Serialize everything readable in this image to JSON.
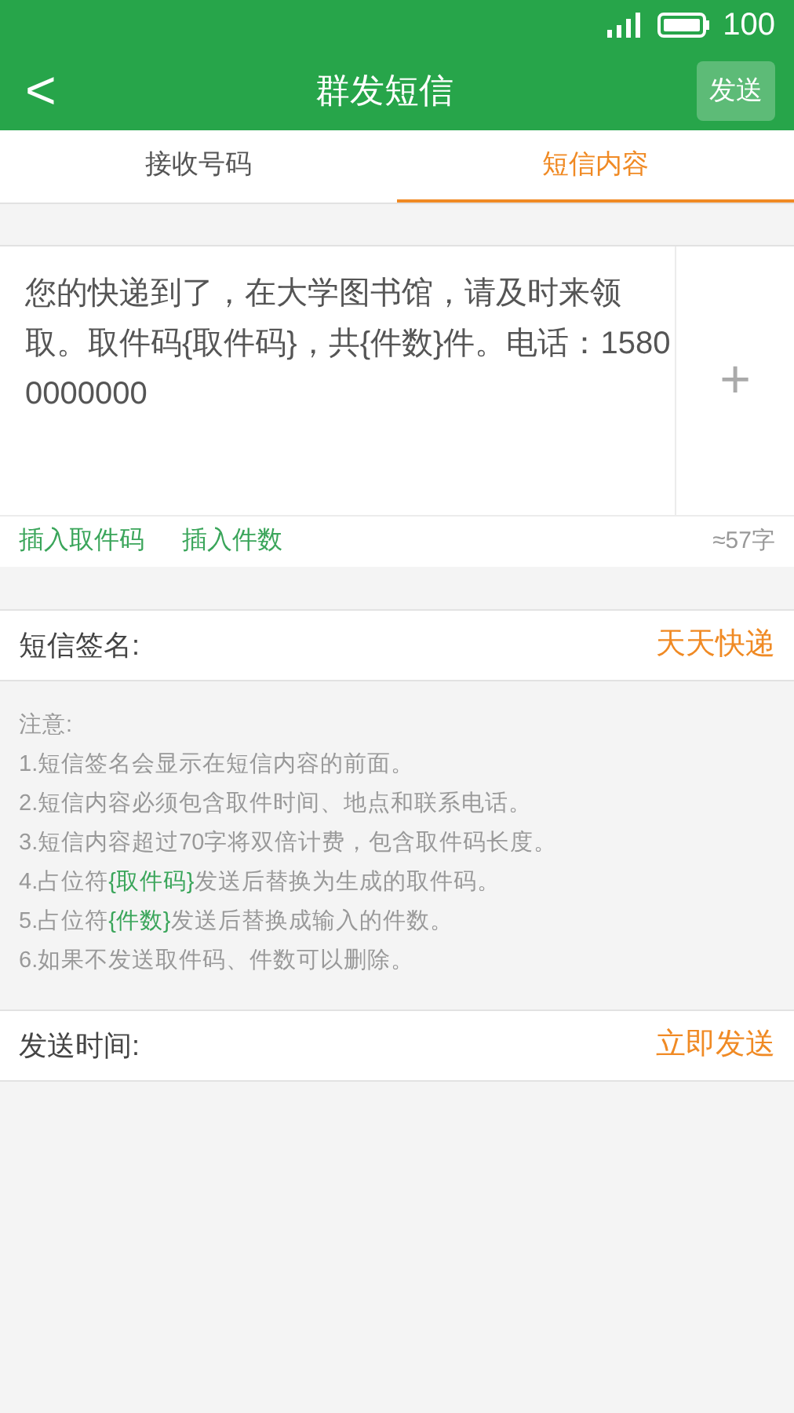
{
  "status_bar": {
    "battery": "100"
  },
  "header": {
    "back": "<",
    "title": "群发短信",
    "send_button": "发送"
  },
  "tabs": [
    {
      "label": "接收号码",
      "selected": false
    },
    {
      "label": "短信内容",
      "selected": true
    }
  ],
  "message": {
    "value": "您的快递到了，在大学图书馆，请及时来领取。取件码{取件码}，共{件数}件。电话：15800000000",
    "add": "+",
    "count": "≈57字"
  },
  "insert_links": [
    "插入取件码",
    "插入件数"
  ],
  "signature": {
    "label": "短信签名:",
    "value": "天天快递"
  },
  "notes": {
    "title": "注意:",
    "items": [
      [
        {
          "text": "1.短信签名会显示在短信内容的前面。",
          "highlight": false
        }
      ],
      [
        {
          "text": "2.短信内容必须包含取件时间、地点和联系电话。",
          "highlight": false
        }
      ],
      [
        {
          "text": "3.短信内容超过70字将双倍计费，包含取件码长度。",
          "highlight": false
        }
      ],
      [
        {
          "text": "4.占位符",
          "highlight": false
        },
        {
          "text": "{取件码}",
          "highlight": true
        },
        {
          "text": "发送后替换为生成的取件码。",
          "highlight": false
        }
      ],
      [
        {
          "text": "5.占位符",
          "highlight": false
        },
        {
          "text": "{件数}",
          "highlight": true
        },
        {
          "text": "发送后替换成输入的件数。",
          "highlight": false
        }
      ],
      [
        {
          "text": "6.如果不发送取件码、件数可以删除。",
          "highlight": false
        }
      ]
    ]
  },
  "send_time": {
    "label": "发送时间:",
    "value": "立即发送"
  }
}
